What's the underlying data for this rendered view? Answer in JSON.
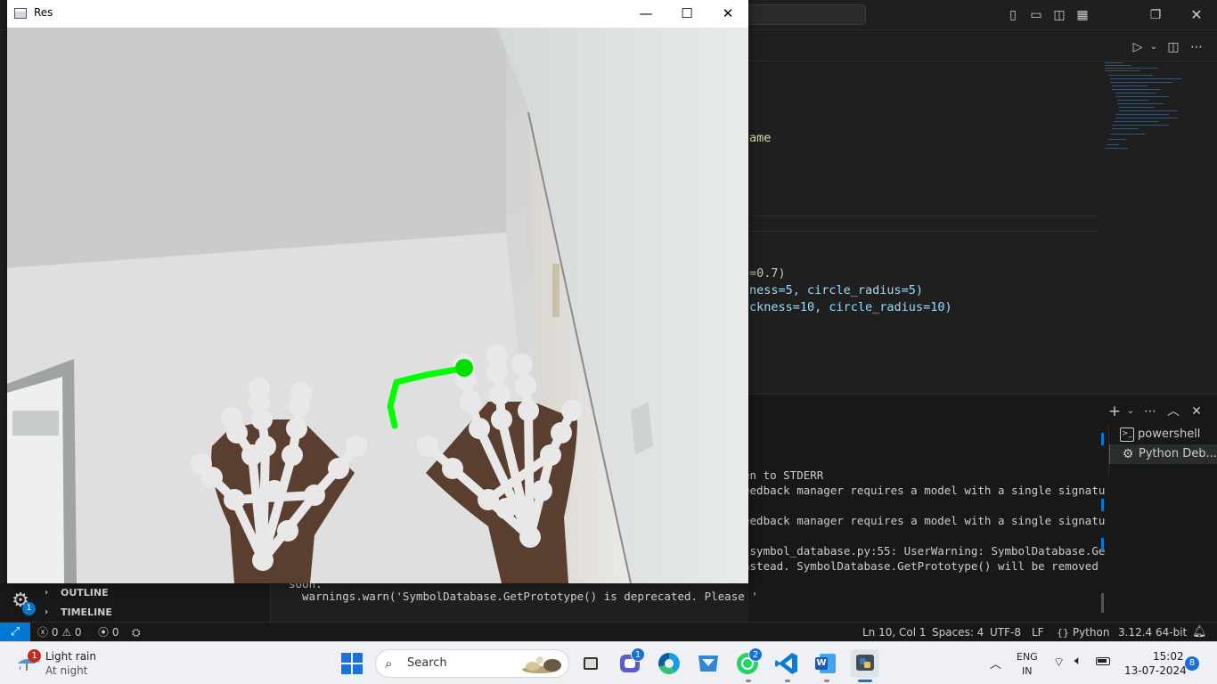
{
  "vscode": {
    "code_fragments": [
      {
        "text": "ame",
        "color": "#dcdcaa"
      },
      {
        "text": "=0.7)",
        "color": "#b5cea8"
      },
      {
        "text": "ness=5, circle_radius=5)",
        "color": "#9cdcfe"
      },
      {
        "text": "ckness=10, circle_radius=10)",
        "color": "#9cdcfe"
      }
    ],
    "terminal_lines": [
      "en to STDERR",
      "eedback manager requires a model with a single signatu",
      "eedback manager requires a model with a single signatu",
      "\\symbol_database.py:55: UserWarning: SymbolDatabase.Ge",
      "nstead. SymbolDatabase.GetPrototype() will be removed",
      "soon.",
      "  warnings.warn('SymbolDatabase.GetPrototype() is deprecated. Please '"
    ],
    "terminals": [
      {
        "label": "powershell",
        "icon": "terminal-icon"
      },
      {
        "label": "Python Deb...",
        "icon": "debug-gear-icon"
      }
    ],
    "sidebar_sections": [
      "OUTLINE",
      "TIMELINE"
    ],
    "gear_badge": "1",
    "status": {
      "errors": "0",
      "warnings": "0",
      "ports": "0",
      "position": "Ln 10, Col 1",
      "spaces": "Spaces: 4",
      "encoding": "UTF-8",
      "eol": "LF",
      "language": "Python",
      "interpreter": "3.12.4 64-bit"
    }
  },
  "res_window": {
    "title": "Res",
    "minimize": "—",
    "maximize": "☐",
    "close": "✕"
  },
  "taskbar": {
    "weather": {
      "title": "Light rain",
      "subtitle": "At night",
      "badge": "1"
    },
    "search_label": "Search",
    "apps": [
      {
        "name": "file-explorer",
        "badge": ""
      },
      {
        "name": "teams",
        "badge": "1"
      },
      {
        "name": "edge",
        "badge": ""
      },
      {
        "name": "store",
        "badge": ""
      },
      {
        "name": "whatsapp",
        "badge": "2"
      },
      {
        "name": "vscode",
        "badge": ""
      },
      {
        "name": "word",
        "badge": ""
      },
      {
        "name": "python",
        "badge": ""
      }
    ],
    "lang_top": "ENG",
    "lang_bottom": "IN",
    "time": "15:02",
    "date": "13-07-2024",
    "notifications": "8"
  },
  "colors": {
    "accent": "#0078d4",
    "stroke_green": "#00ff00",
    "landmark_white": "#e8e8e8"
  }
}
